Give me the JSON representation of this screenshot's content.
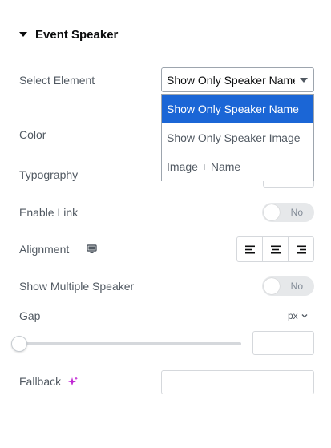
{
  "section": {
    "title": "Event Speaker"
  },
  "select_element": {
    "label": "Select Element",
    "value": "Show Only Speaker Name",
    "options": [
      "Show Only Speaker Name",
      "Show Only Speaker Image",
      "Image + Name"
    ],
    "selected_index": 0
  },
  "color": {
    "label": "Color"
  },
  "typography": {
    "label": "Typography"
  },
  "enable_link": {
    "label": "Enable Link",
    "state": "No",
    "on": false
  },
  "alignment": {
    "label": "Alignment",
    "device_icon": "desktop-icon",
    "options": [
      "align-left-icon",
      "align-center-icon",
      "align-right-icon"
    ]
  },
  "multiple_speaker": {
    "label": "Show Multiple Speaker",
    "state": "No",
    "on": false
  },
  "gap": {
    "label": "Gap",
    "unit": "px",
    "value": "",
    "slider_fraction": 0
  },
  "fallback": {
    "label": "Fallback",
    "ai_icon": "sparkle-icon",
    "value": ""
  },
  "colors": {
    "selected_option": "#1b66d6",
    "toggle_off": "#e6e8ea",
    "ai_accent": "#c026d3"
  }
}
